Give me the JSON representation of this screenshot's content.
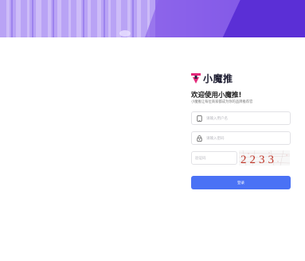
{
  "brand": {
    "name": "小魔推",
    "accent": "#e5287a",
    "logo_dark": "#2b1f3f"
  },
  "login": {
    "welcome": "欢迎使用小魔推!",
    "subtitle": "小魔推让每位商家都成为你的品牌推荐官",
    "username_placeholder": "请输入用户名",
    "password_placeholder": "请输入密码",
    "captcha_placeholder": "验证码",
    "captcha_code": "2233",
    "submit_label": "登录"
  },
  "colors": {
    "primary": "#4a72f5",
    "banner_start": "#a88df2",
    "banner_end": "#5a2fd8"
  },
  "icons": {
    "username": "phone-icon",
    "password": "lock-icon"
  }
}
